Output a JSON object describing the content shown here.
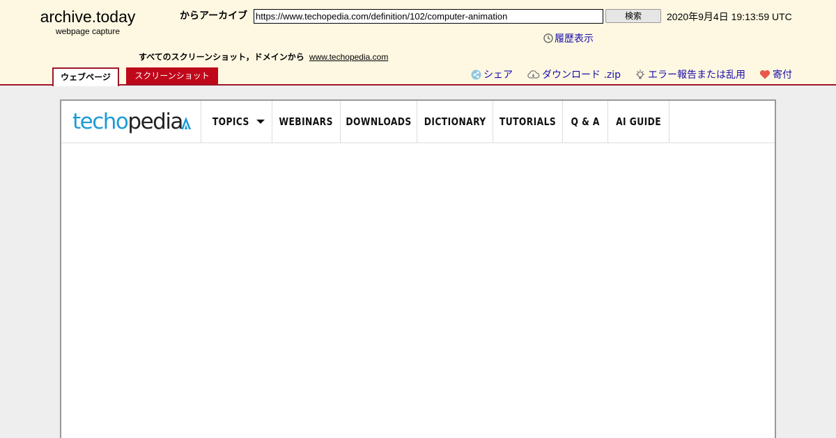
{
  "archive": {
    "brand_title": "archive.today",
    "brand_subtitle": "webpage capture",
    "from_label": "からアーカイブ",
    "url_value": "https://www.techopedia.com/definition/102/computer-animation",
    "search_button": "検索",
    "capture_date": "2020年9月4日 19:13:59 UTC",
    "history_link": "履歴表示",
    "all_screenshots_label": "すべてのスクリーンショット，ドメインから",
    "domain_link": "www.techopedia.com",
    "tabs": [
      {
        "label": "ウェブページ",
        "active": true
      },
      {
        "label": "スクリーンショット",
        "active": false
      }
    ],
    "actions": [
      {
        "label": "シェア",
        "icon": "share-icon"
      },
      {
        "label": "ダウンロード .zip",
        "icon": "cloud-download-icon"
      },
      {
        "label": "エラー報告または乱用",
        "icon": "lightbulb-icon"
      },
      {
        "label": "寄付",
        "icon": "heart-icon"
      }
    ],
    "colors": {
      "header_bg": "#fef8e2",
      "accent": "#a0142a",
      "link": "#1a0dab"
    }
  },
  "site": {
    "logo_part1": "techo",
    "logo_part2": "pedia",
    "nav": [
      "TOPICS",
      "WEBINARS",
      "DOWNLOADS",
      "DICTIONARY",
      "TUTORIALS",
      "Q & A",
      "AI GUIDE"
    ],
    "colors": {
      "logo_blue": "#1e9bd7"
    }
  }
}
